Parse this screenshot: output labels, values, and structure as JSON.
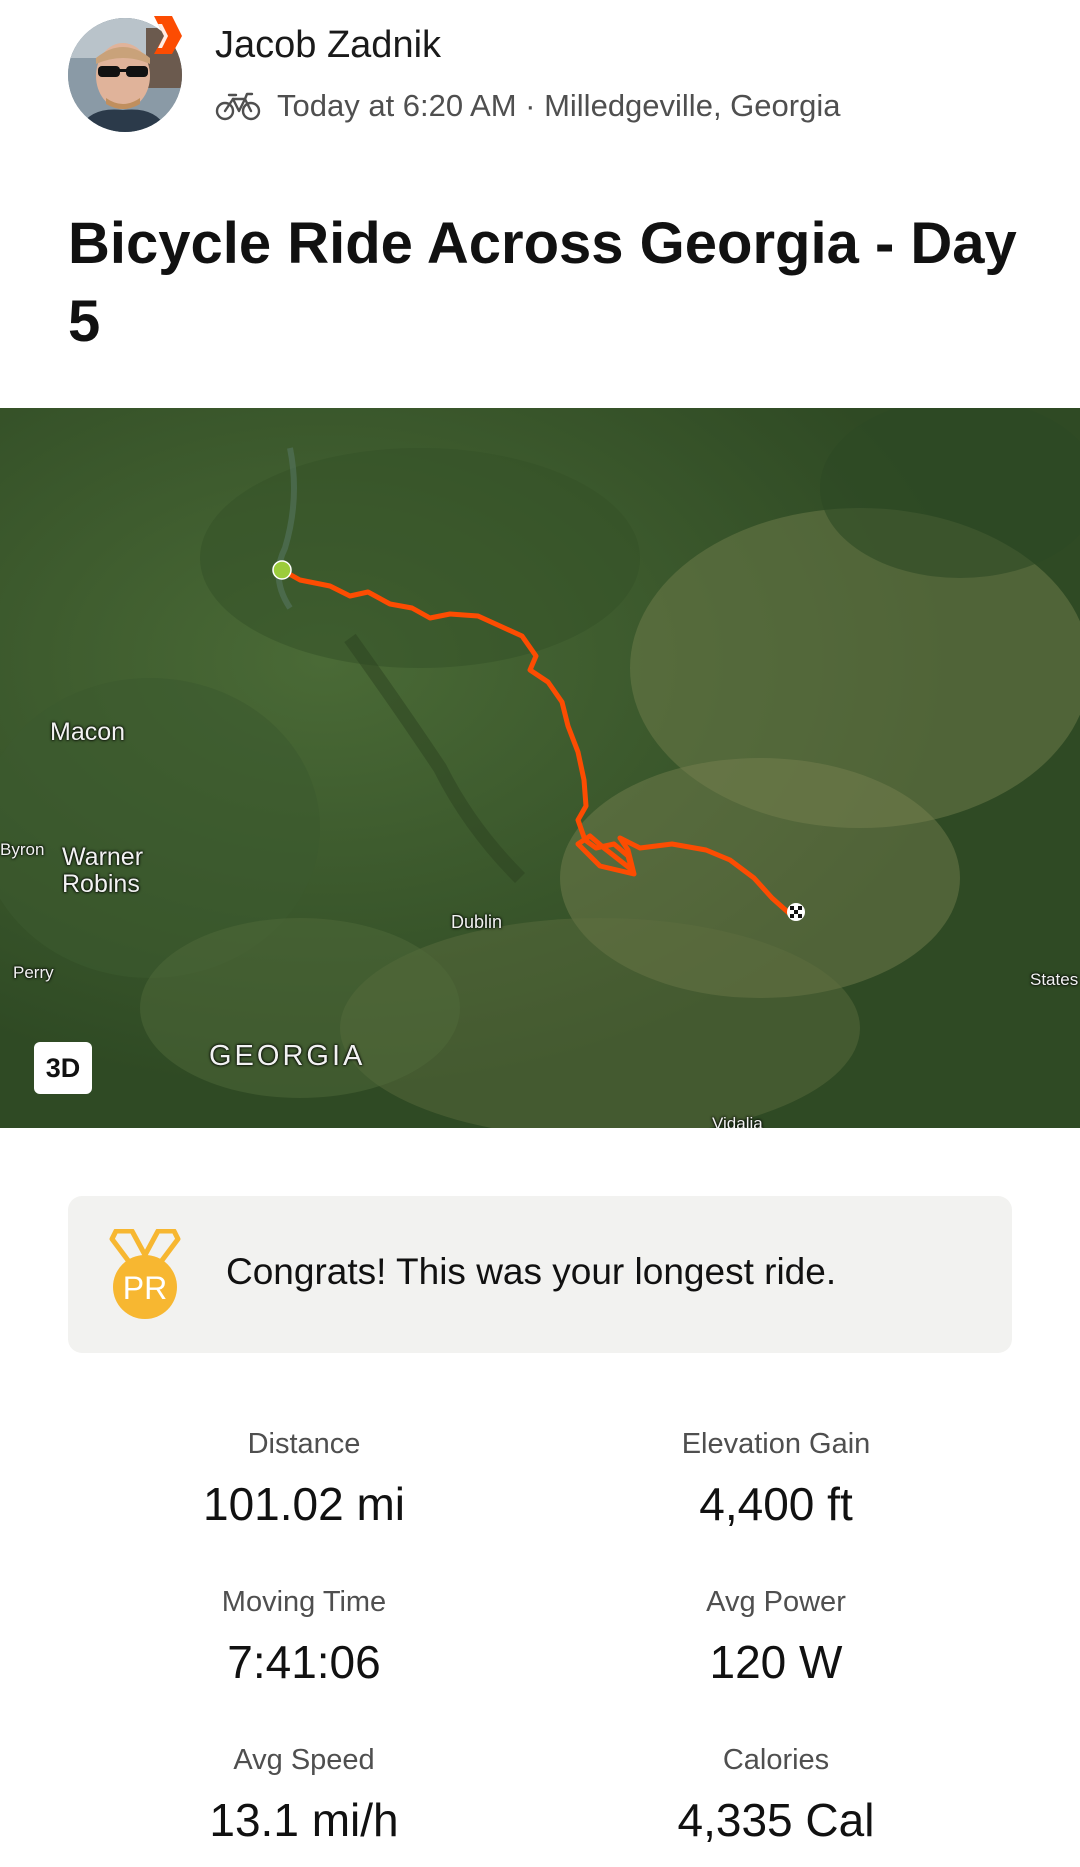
{
  "athlete": {
    "name": "Jacob Zadnik",
    "activity_icon": "bike-icon",
    "meta": "Today at 6:20 AM · Milledgeville, Georgia"
  },
  "activity": {
    "title": "Bicycle Ride Across Georgia - Day 5"
  },
  "map": {
    "labels": {
      "macon": "Macon",
      "byron": "Byron",
      "warner_robins": "Warner Robins",
      "dublin": "Dublin",
      "perry": "Perry",
      "states": "States",
      "georgia": "GEORGIA",
      "vidalia": "Vidalia"
    },
    "view_toggle": "3D",
    "route_color": "#fc4c02",
    "start_marker_color": "#9ccc3c"
  },
  "achievement": {
    "icon": "medal-icon",
    "badge_text": "PR",
    "text": "Congrats! This was your longest ride.",
    "color": "#f7b731"
  },
  "stats": [
    {
      "label": "Distance",
      "value": "101.02 mi"
    },
    {
      "label": "Elevation Gain",
      "value": "4,400 ft"
    },
    {
      "label": "Moving Time",
      "value": "7:41:06"
    },
    {
      "label": "Avg Power",
      "value": "120 W"
    },
    {
      "label": "Avg Speed",
      "value": "13.1 mi/h"
    },
    {
      "label": "Calories",
      "value": "4,335 Cal"
    }
  ]
}
